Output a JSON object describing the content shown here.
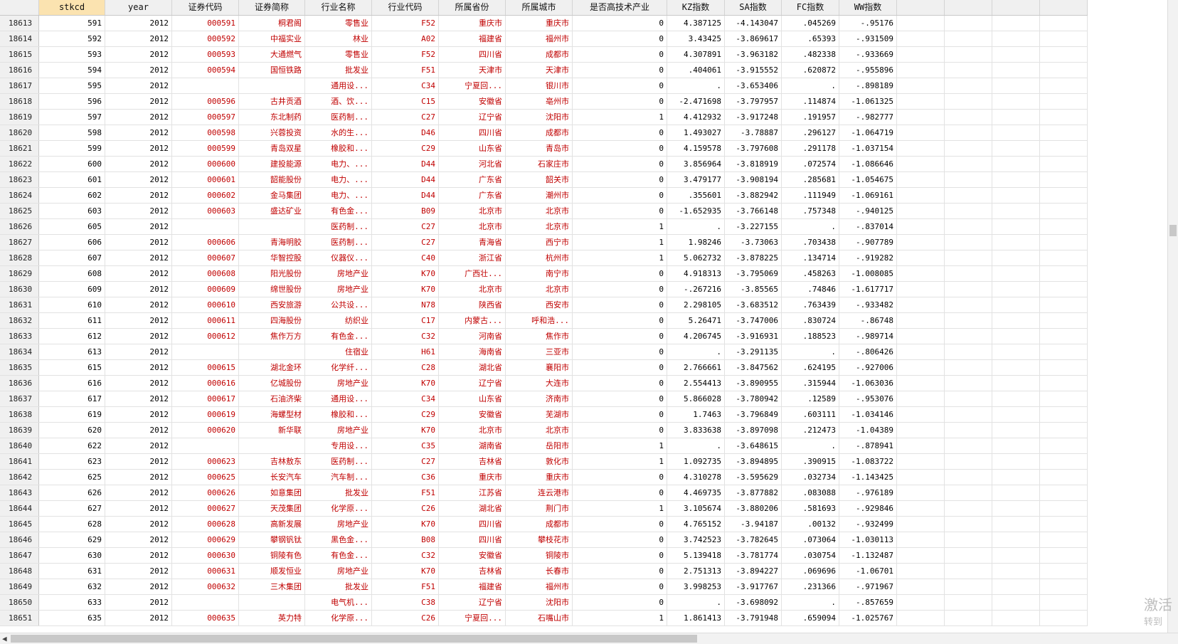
{
  "columns": [
    "",
    "stkcd",
    "year",
    "证券代码",
    "证券简称",
    "行业名称",
    "行业代码",
    "所属省份",
    "所属城市",
    "是否高技术产业",
    "KZ指数",
    "SA指数",
    "FC指数",
    "WW指数"
  ],
  "selected_column": "stkcd",
  "rows": [
    [
      "18613",
      "591",
      "2012",
      "000591",
      "桐君阁",
      "零售业",
      "F52",
      "重庆市",
      "重庆市",
      "0",
      "4.387125",
      "-4.143047",
      ".045269",
      "-.95176"
    ],
    [
      "18614",
      "592",
      "2012",
      "000592",
      "中福实业",
      "林业",
      "A02",
      "福建省",
      "福州市",
      "0",
      "3.43425",
      "-3.869617",
      ".65393",
      "-.931509"
    ],
    [
      "18615",
      "593",
      "2012",
      "000593",
      "大通燃气",
      "零售业",
      "F52",
      "四川省",
      "成都市",
      "0",
      "4.307891",
      "-3.963182",
      ".482338",
      "-.933669"
    ],
    [
      "18616",
      "594",
      "2012",
      "000594",
      "国恒铁路",
      "批发业",
      "F51",
      "天津市",
      "天津市",
      "0",
      ".404061",
      "-3.915552",
      ".620872",
      "-.955896"
    ],
    [
      "18617",
      "595",
      "2012",
      "",
      "",
      "通用设...",
      "C34",
      "宁夏回...",
      "银川市",
      "0",
      ".",
      "-3.653406",
      ".",
      "-.898189"
    ],
    [
      "18618",
      "596",
      "2012",
      "000596",
      "古井贡酒",
      "酒、饮...",
      "C15",
      "安徽省",
      "亳州市",
      "0",
      "-2.471698",
      "-3.797957",
      ".114874",
      "-1.061325"
    ],
    [
      "18619",
      "597",
      "2012",
      "000597",
      "东北制药",
      "医药制...",
      "C27",
      "辽宁省",
      "沈阳市",
      "1",
      "4.412932",
      "-3.917248",
      ".191957",
      "-.982777"
    ],
    [
      "18620",
      "598",
      "2012",
      "000598",
      "兴蓉投资",
      "水的生...",
      "D46",
      "四川省",
      "成都市",
      "0",
      "1.493027",
      "-3.78887",
      ".296127",
      "-1.064719"
    ],
    [
      "18621",
      "599",
      "2012",
      "000599",
      "青岛双星",
      "橡胶和...",
      "C29",
      "山东省",
      "青岛市",
      "0",
      "4.159578",
      "-3.797608",
      ".291178",
      "-1.037154"
    ],
    [
      "18622",
      "600",
      "2012",
      "000600",
      "建投能源",
      "电力、...",
      "D44",
      "河北省",
      "石家庄市",
      "0",
      "3.856964",
      "-3.818919",
      ".072574",
      "-1.086646"
    ],
    [
      "18623",
      "601",
      "2012",
      "000601",
      "韶能股份",
      "电力、...",
      "D44",
      "广东省",
      "韶关市",
      "0",
      "3.479177",
      "-3.908194",
      ".285681",
      "-1.054675"
    ],
    [
      "18624",
      "602",
      "2012",
      "000602",
      "金马集团",
      "电力、...",
      "D44",
      "广东省",
      "潮州市",
      "0",
      ".355601",
      "-3.882942",
      ".111949",
      "-1.069161"
    ],
    [
      "18625",
      "603",
      "2012",
      "000603",
      "盛达矿业",
      "有色金...",
      "B09",
      "北京市",
      "北京市",
      "0",
      "-1.652935",
      "-3.766148",
      ".757348",
      "-.940125"
    ],
    [
      "18626",
      "605",
      "2012",
      "",
      "",
      "医药制...",
      "C27",
      "北京市",
      "北京市",
      "1",
      ".",
      "-3.227155",
      ".",
      "-.837014"
    ],
    [
      "18627",
      "606",
      "2012",
      "000606",
      "青海明胶",
      "医药制...",
      "C27",
      "青海省",
      "西宁市",
      "1",
      "1.98246",
      "-3.73063",
      ".703438",
      "-.907789"
    ],
    [
      "18628",
      "607",
      "2012",
      "000607",
      "华智控股",
      "仪器仪...",
      "C40",
      "浙江省",
      "杭州市",
      "1",
      "5.062732",
      "-3.878225",
      ".134714",
      "-.919282"
    ],
    [
      "18629",
      "608",
      "2012",
      "000608",
      "阳光股份",
      "房地产业",
      "K70",
      "广西壮...",
      "南宁市",
      "0",
      "4.918313",
      "-3.795069",
      ".458263",
      "-1.008085"
    ],
    [
      "18630",
      "609",
      "2012",
      "000609",
      "绵世股份",
      "房地产业",
      "K70",
      "北京市",
      "北京市",
      "0",
      "-.267216",
      "-3.85565",
      ".74846",
      "-1.617717"
    ],
    [
      "18631",
      "610",
      "2012",
      "000610",
      "西安旅游",
      "公共设...",
      "N78",
      "陕西省",
      "西安市",
      "0",
      "2.298105",
      "-3.683512",
      ".763439",
      "-.933482"
    ],
    [
      "18632",
      "611",
      "2012",
      "000611",
      "四海股份",
      "纺织业",
      "C17",
      "内蒙古...",
      "呼和浩...",
      "0",
      "5.26471",
      "-3.747006",
      ".830724",
      "-.86748"
    ],
    [
      "18633",
      "612",
      "2012",
      "000612",
      "焦作万方",
      "有色金...",
      "C32",
      "河南省",
      "焦作市",
      "0",
      "4.206745",
      "-3.916931",
      ".188523",
      "-.989714"
    ],
    [
      "18634",
      "613",
      "2012",
      "",
      "",
      "住宿业",
      "H61",
      "海南省",
      "三亚市",
      "0",
      ".",
      "-3.291135",
      ".",
      "-.806426"
    ],
    [
      "18635",
      "615",
      "2012",
      "000615",
      "湖北金环",
      "化学纤...",
      "C28",
      "湖北省",
      "襄阳市",
      "0",
      "2.766661",
      "-3.847562",
      ".624195",
      "-.927006"
    ],
    [
      "18636",
      "616",
      "2012",
      "000616",
      "亿城股份",
      "房地产业",
      "K70",
      "辽宁省",
      "大连市",
      "0",
      "2.554413",
      "-3.890955",
      ".315944",
      "-1.063036"
    ],
    [
      "18637",
      "617",
      "2012",
      "000617",
      "石油济柴",
      "通用设...",
      "C34",
      "山东省",
      "济南市",
      "0",
      "5.866028",
      "-3.780942",
      ".12589",
      "-.953076"
    ],
    [
      "18638",
      "619",
      "2012",
      "000619",
      "海螺型材",
      "橡胶和...",
      "C29",
      "安徽省",
      "芜湖市",
      "0",
      "1.7463",
      "-3.796849",
      ".603111",
      "-1.034146"
    ],
    [
      "18639",
      "620",
      "2012",
      "000620",
      "新华联",
      "房地产业",
      "K70",
      "北京市",
      "北京市",
      "0",
      "3.833638",
      "-3.897098",
      ".212473",
      "-1.04389"
    ],
    [
      "18640",
      "622",
      "2012",
      "",
      "",
      "专用设...",
      "C35",
      "湖南省",
      "岳阳市",
      "1",
      ".",
      "-3.648615",
      ".",
      "-.878941"
    ],
    [
      "18641",
      "623",
      "2012",
      "000623",
      "吉林敖东",
      "医药制...",
      "C27",
      "吉林省",
      "敦化市",
      "1",
      "1.092735",
      "-3.894895",
      ".390915",
      "-1.083722"
    ],
    [
      "18642",
      "625",
      "2012",
      "000625",
      "长安汽车",
      "汽车制...",
      "C36",
      "重庆市",
      "重庆市",
      "0",
      "4.310278",
      "-3.595629",
      ".032734",
      "-1.143425"
    ],
    [
      "18643",
      "626",
      "2012",
      "000626",
      "如意集团",
      "批发业",
      "F51",
      "江苏省",
      "连云港市",
      "0",
      "4.469735",
      "-3.877882",
      ".083088",
      "-.976189"
    ],
    [
      "18644",
      "627",
      "2012",
      "000627",
      "天茂集团",
      "化学原...",
      "C26",
      "湖北省",
      "荆门市",
      "1",
      "3.105674",
      "-3.880206",
      ".581693",
      "-.929846"
    ],
    [
      "18645",
      "628",
      "2012",
      "000628",
      "高新发展",
      "房地产业",
      "K70",
      "四川省",
      "成都市",
      "0",
      "4.765152",
      "-3.94187",
      ".00132",
      "-.932499"
    ],
    [
      "18646",
      "629",
      "2012",
      "000629",
      "攀钢钒钛",
      "黑色金...",
      "B08",
      "四川省",
      "攀枝花市",
      "0",
      "3.742523",
      "-3.782645",
      ".073064",
      "-1.030113"
    ],
    [
      "18647",
      "630",
      "2012",
      "000630",
      "铜陵有色",
      "有色金...",
      "C32",
      "安徽省",
      "铜陵市",
      "0",
      "5.139418",
      "-3.781774",
      ".030754",
      "-1.132487"
    ],
    [
      "18648",
      "631",
      "2012",
      "000631",
      "顺发恒业",
      "房地产业",
      "K70",
      "吉林省",
      "长春市",
      "0",
      "2.751313",
      "-3.894227",
      ".069696",
      "-1.06701"
    ],
    [
      "18649",
      "632",
      "2012",
      "000632",
      "三木集团",
      "批发业",
      "F51",
      "福建省",
      "福州市",
      "0",
      "3.998253",
      "-3.917767",
      ".231366",
      "-.971967"
    ],
    [
      "18650",
      "633",
      "2012",
      "",
      "",
      "电气机...",
      "C38",
      "辽宁省",
      "沈阳市",
      "0",
      ".",
      "-3.698092",
      ".",
      "-.857659"
    ],
    [
      "18651",
      "635",
      "2012",
      "000635",
      "英力特",
      "化学原...",
      "C26",
      "宁夏回...",
      "石嘴山市",
      "1",
      "1.861413",
      "-3.791948",
      ".659094",
      "-1.025767"
    ]
  ],
  "colors": {
    "header_bg": "#f0f0f0",
    "selected_header": "#fbe3b0",
    "red_text": "#c00000"
  },
  "watermark": {
    "line1": "激活",
    "line2": "转到"
  },
  "icons": {
    "scroll_left": "left-arrow-icon"
  }
}
